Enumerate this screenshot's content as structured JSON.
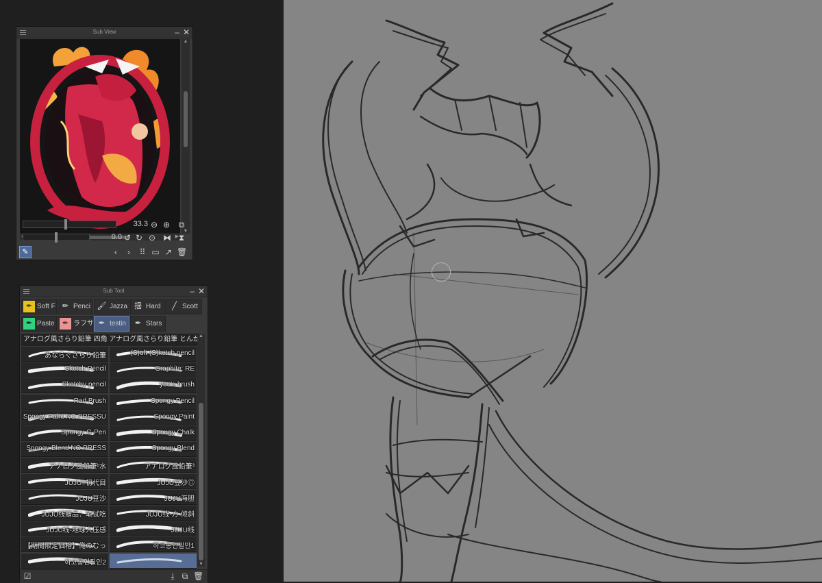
{
  "subview": {
    "title": "Sub View",
    "zoom": "33.3",
    "rotation": "0.0"
  },
  "subtool": {
    "title": "Sub Tool",
    "tabs": [
      {
        "label": "Soft F",
        "icon": "pen-icon",
        "style": "yellow"
      },
      {
        "label": "Penci",
        "icon": "pencil-icon",
        "style": ""
      },
      {
        "label": "Jazza",
        "icon": "brush-icon",
        "style": ""
      },
      {
        "label": "Hard",
        "icon": "kanji-icon",
        "glyph": "揺",
        "style": ""
      },
      {
        "label": "Scott",
        "icon": "line-icon",
        "style": ""
      },
      {
        "label": "Paste",
        "icon": "pen-icon",
        "style": "green"
      },
      {
        "label": "ラフサ",
        "icon": "pen-icon",
        "style": "pink"
      },
      {
        "label": "testin",
        "icon": "pen-icon",
        "style": "",
        "selected": true
      },
      {
        "label": "Stars",
        "icon": "pen-icon",
        "style": ""
      }
    ],
    "group_header": "アナログ風さらり鉛筆 四角 アナログ風さらり鉛筆 とんが",
    "brushes": [
      {
        "label": "あならぐざらり鉛筆"
      },
      {
        "label": "(S)oft (S)ketch pencil"
      },
      {
        "label": "Sketch Pencil"
      },
      {
        "label": "Graphite: RE"
      },
      {
        "label": "Sketchy pencil"
      },
      {
        "label": "you's brush"
      },
      {
        "label": "Rad Brush"
      },
      {
        "label": "Spongy Pencil"
      },
      {
        "label": "Spongy Paint NO PRESSU"
      },
      {
        "label": "Spongy Paint"
      },
      {
        "label": "Spongy G-Pen"
      },
      {
        "label": "Spongy Chalk"
      },
      {
        "label": "Spongy Blend NO PRESS"
      },
      {
        "label": "Spongy Blend"
      },
      {
        "label": "アナログ風鉛筆ᵇ水"
      },
      {
        "label": "アナログ風鉛筆³"
      },
      {
        "label": "JUJU≡初代目"
      },
      {
        "label": "JUJU豆沙◎"
      },
      {
        "label": "JUJU豆沙"
      },
      {
        "label": "JUJU海胆"
      },
      {
        "label": "JUJU线赠品：笔试吃"
      },
      {
        "label": "JUJU线-方-倾斜"
      },
      {
        "label": "JUJU线-地球人压感"
      },
      {
        "label": "JUJU线"
      },
      {
        "label": "【期間限定価格】俺のむっ"
      },
      {
        "label": "하코롱연필인1"
      },
      {
        "label": "하코롱연필인2"
      },
      {
        "label": "",
        "selected": true
      }
    ]
  },
  "colors": {
    "canvas": "#858585",
    "panel": "#3a3a3a",
    "selection": "#586d96"
  }
}
